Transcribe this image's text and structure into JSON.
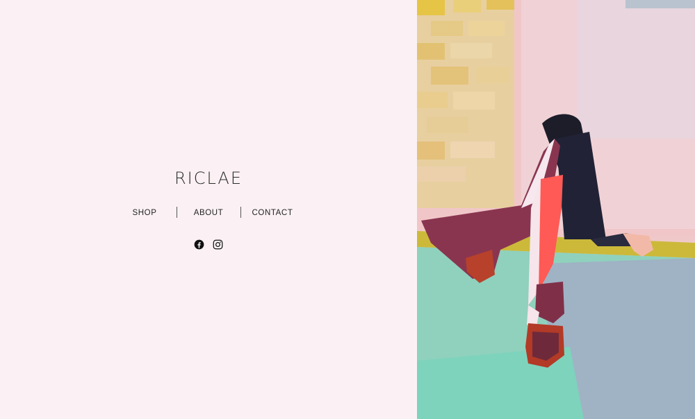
{
  "brand": {
    "name": "RICLAE"
  },
  "nav": {
    "items": [
      {
        "label": "SHOP"
      },
      {
        "label": "ABOUT"
      },
      {
        "label": "CONTACT"
      }
    ]
  },
  "social": {
    "icons": [
      "facebook-icon",
      "instagram-icon"
    ]
  },
  "hero": {
    "image": "painting-woman-sitting-on-ledge"
  },
  "colors": {
    "background": "#fbf1f4",
    "text": "#222222"
  }
}
